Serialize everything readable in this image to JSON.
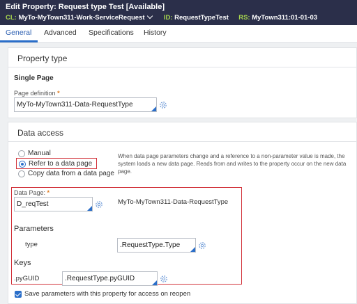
{
  "header": {
    "title": "Edit  Property: Request type Test [Available]",
    "cl_label": "CL:",
    "cl_value": "MyTo-MyTown311-Work-ServiceRequest",
    "id_label": "ID:",
    "id_value": "RequestTypeTest",
    "rs_label": "RS:",
    "rs_value": "MyTown311:01-01-03"
  },
  "tabs": [
    {
      "label": "General",
      "active": true
    },
    {
      "label": "Advanced",
      "active": false
    },
    {
      "label": "Specifications",
      "active": false
    },
    {
      "label": "History",
      "active": false
    }
  ],
  "property_type": {
    "heading": "Property type",
    "mode": "Single Page",
    "page_definition_label": "Page definition",
    "page_definition_value": "MyTo-MyTown311-Data-RequestType"
  },
  "data_access": {
    "heading": "Data access",
    "options": [
      "Manual",
      "Refer to a data page",
      "Copy data from a data page"
    ],
    "selected_option": "Refer to a data page",
    "help_text": "When data page parameters change and a reference to a non-parameter value is made, the system loads a new data page. Reads from and writes to the property occur on the new data page.",
    "data_page_label": "Data Page:",
    "data_page_value": "D_reqTest",
    "data_page_class": "MyTo-MyTown311-Data-RequestType",
    "parameters_heading": "Parameters",
    "param_name": "type",
    "param_value": ".RequestType.Type",
    "keys_heading": "Keys",
    "key_name": ".pyGUID",
    "key_value": ".RequestType.pyGUID",
    "save_params_label": "Save parameters with this property for access on reopen",
    "save_params_checked": true
  },
  "colors": {
    "header_bg": "#2b2f4a",
    "header_label": "#a7d64d",
    "accent": "#2a6ec9",
    "highlight_border": "#d2333b",
    "required": "#e07b1f"
  }
}
